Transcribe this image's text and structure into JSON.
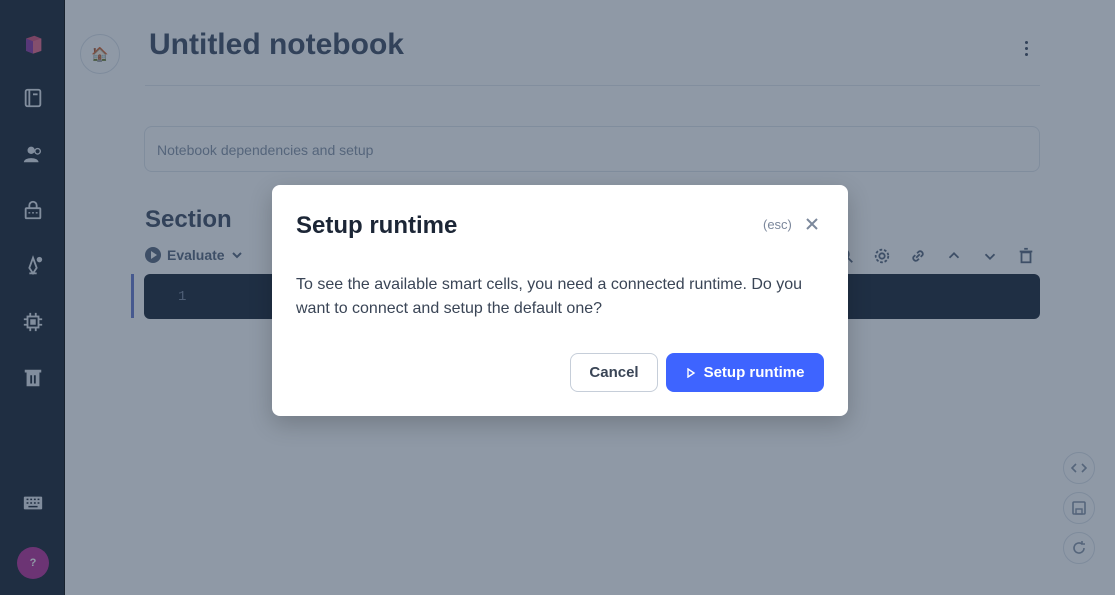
{
  "notebook": {
    "title": "Untitled notebook",
    "setup_placeholder": "Notebook dependencies and setup"
  },
  "section": {
    "title": "Section",
    "evaluate_label": "Evaluate",
    "line_number": "1"
  },
  "sidebar": {
    "icons": [
      "logo-icon",
      "notebooks-icon",
      "users-icon",
      "secrets-icon",
      "hubs-icon",
      "runtime-icon",
      "bin-icon",
      "keyboard-icon"
    ],
    "help_label": "?"
  },
  "modal": {
    "title": "Setup runtime",
    "esc_hint": "(esc)",
    "message": "To see the available smart cells, you need a connected runtime. Do you want to connect and setup the default one?",
    "cancel_label": "Cancel",
    "confirm_label": "Setup runtime"
  },
  "colors": {
    "primary": "#3e64ff",
    "sidebar": "#1e2836",
    "overlay": "#1f334e"
  }
}
